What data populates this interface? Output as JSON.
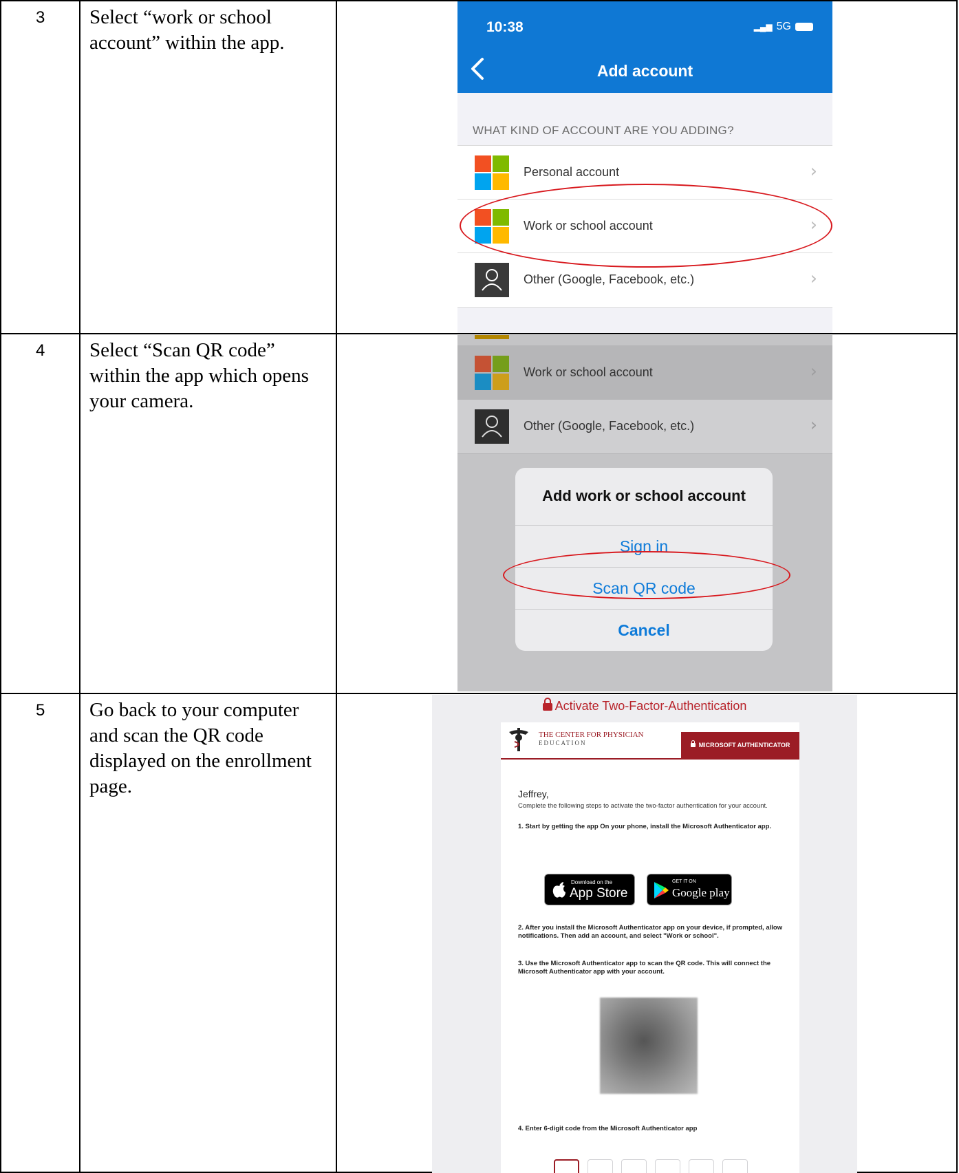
{
  "steps": [
    {
      "number": "3",
      "text": "Select “work or school account” within the app."
    },
    {
      "number": "4",
      "text": "Select “Scan QR code” within the app which opens your camera."
    },
    {
      "number": "5",
      "text": "Go back to your computer and scan the QR code displayed on the enrollment page."
    }
  ],
  "phone1": {
    "time": "10:38",
    "network": "5G",
    "title": "Add account",
    "section_header": "WHAT KIND OF ACCOUNT ARE YOU ADDING?",
    "rows": [
      {
        "label": "Personal account",
        "icon": "microsoft-logo-icon"
      },
      {
        "label": "Work or school account",
        "icon": "microsoft-logo-icon"
      },
      {
        "label": "Other (Google, Facebook, etc.)",
        "icon": "person-icon"
      }
    ],
    "highlight_color": "#d8191e"
  },
  "phone2": {
    "rows": [
      {
        "label": "Work or school account"
      },
      {
        "label": "Other (Google, Facebook, etc.)"
      }
    ],
    "dialog": {
      "title": "Add work or school account",
      "sign_in": "Sign in",
      "scan_qr": "Scan QR code",
      "cancel": "Cancel"
    }
  },
  "web": {
    "top_title": "Activate Two-Factor-Authentication",
    "logo_line1": "THE CENTER FOR PHYSICIAN",
    "logo_line2": "EDUCATION",
    "tab_label": "MICROSOFT AUTHENTICATOR",
    "greeting": "Jeffrey,",
    "intro": "Complete the following steps to activate the two-factor authentication for your account.",
    "step1": "1. Start by getting the app On your phone, install the Microsoft Authenticator app.",
    "appstore_small": "Download on the",
    "appstore_big": "App Store",
    "googleplay_small": "GET IT ON",
    "googleplay_big": "Google play",
    "step2": "2. After you install the Microsoft Authenticator app on your device, if prompted, allow notifications. Then add an account, and select \"Work or school\".",
    "step3": "3. Use the Microsoft Authenticator app to scan the QR code. This will connect the Microsoft Authenticator app with your account.",
    "step4": "4. Enter 6-digit code from the Microsoft Authenticator app",
    "accent_color": "#9b1c25"
  }
}
